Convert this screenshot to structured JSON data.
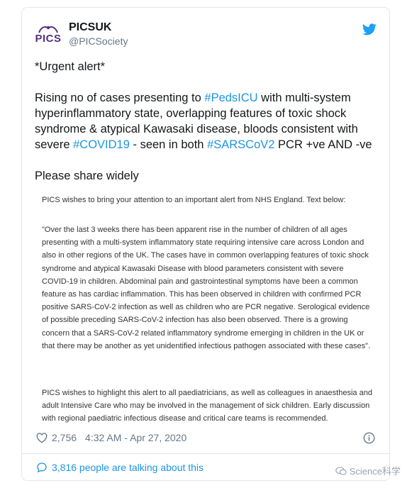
{
  "tweet": {
    "display_name": "PICSUK",
    "handle": "@PICSociety",
    "avatar_text": "PICS",
    "line1": "*Urgent alert*",
    "para": {
      "a": "Rising no of cases presenting to ",
      "tag1": "#PedsICU",
      "b": " with multi-system hyperinflammatory state, overlapping features of toxic shock syndrome & atypical Kawasaki disease, bloods consistent with severe ",
      "tag2": "#COVID19",
      "c": " - seen in both ",
      "tag3": "#SARSCoV2",
      "d": " PCR +ve AND -ve"
    },
    "line3": "Please share widely"
  },
  "notice": {
    "p1": "PICS wishes to bring your attention to an important alert from NHS England. Text below:",
    "p2": "\"Over the last 3 weeks there has been apparent rise in the number of children of all ages presenting with a multi-system inflammatory state requiring intensive care across London and also in other regions of the UK. The cases have in common overlapping features of toxic shock syndrome and atypical Kawasaki Disease with blood parameters consistent with severe COVID-19 in children. Abdominal pain and gastrointestinal symptoms have been a common feature as has cardiac inflammation. This has been observed in children with confirmed PCR positive SARS-CoV-2 infection as well as children who are PCR negative. Serological evidence of possible preceding SARS-CoV-2 infection has also been observed. There is a growing concern that a SARS-CoV-2 related inflammatory syndrome emerging in children in the UK or that there may be another as yet unidentified infectious pathogen associated with these cases\".",
    "p3": "PICS wishes to highlight this alert to all paediatricians, as well as colleagues in anaesthesia and adult Intensive Care who may be involved in the management of sick children. Early discussion with regional paediatric infectious disease and critical care teams is recommended."
  },
  "meta": {
    "likes": "2,756",
    "timestamp": "4:32 AM - Apr 27, 2020"
  },
  "talking": "3,816 people are talking about this",
  "watermark": "Science科学",
  "colors": {
    "accent": "#1b95e0",
    "text": "#14171a",
    "muted": "#657786",
    "border": "#e1e8ed"
  },
  "icons": [
    "twitter-bird-icon",
    "heart-icon",
    "info-icon",
    "speech-bubble-icon",
    "wechat-icon"
  ]
}
